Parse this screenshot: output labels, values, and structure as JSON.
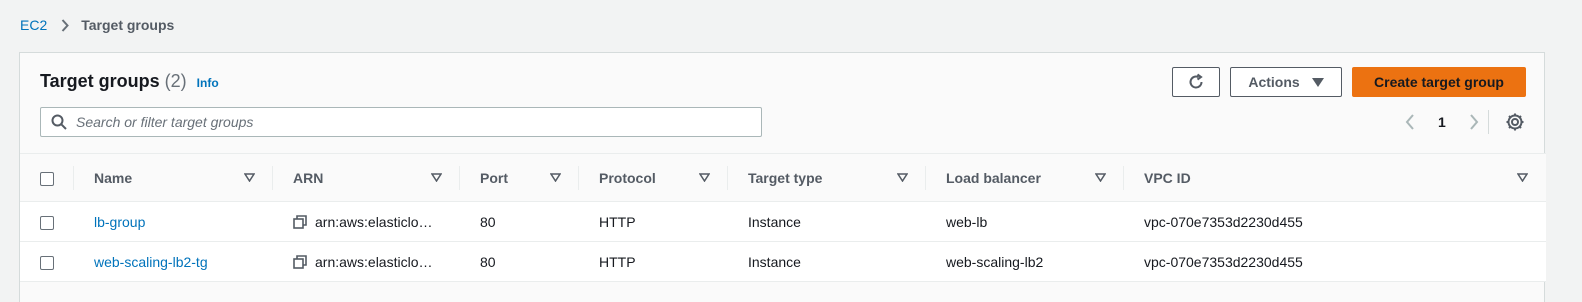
{
  "breadcrumb": {
    "root": "EC2",
    "current": "Target groups"
  },
  "header": {
    "title": "Target groups",
    "count": "(2)",
    "info": "Info",
    "actions_label": "Actions",
    "create_label": "Create target group"
  },
  "search": {
    "placeholder": "Search or filter target groups",
    "value": ""
  },
  "pagination": {
    "current_page": "1"
  },
  "table": {
    "columns": [
      "Name",
      "ARN",
      "Port",
      "Protocol",
      "Target type",
      "Load balancer",
      "VPC ID"
    ],
    "rows": [
      {
        "name": "lb-group",
        "arn": "arn:aws:elasticlo…",
        "port": "80",
        "protocol": "HTTP",
        "target_type": "Instance",
        "load_balancer": "web-lb",
        "vpc_id": "vpc-070e7353d2230d455"
      },
      {
        "name": "web-scaling-lb2-tg",
        "arn": "arn:aws:elasticlo…",
        "port": "80",
        "protocol": "HTTP",
        "target_type": "Instance",
        "load_balancer": "web-scaling-lb2",
        "vpc_id": "vpc-070e7353d2230d455"
      }
    ]
  },
  "colors": {
    "link": "#0073bb",
    "primary": "#ec7211",
    "text": "#16191f",
    "muted": "#545b64"
  },
  "icons": [
    "chevron-right-icon",
    "refresh-icon",
    "caret-down-icon",
    "search-icon",
    "chevron-left-icon",
    "settings-icon",
    "filter-icon",
    "copy-icon"
  ]
}
